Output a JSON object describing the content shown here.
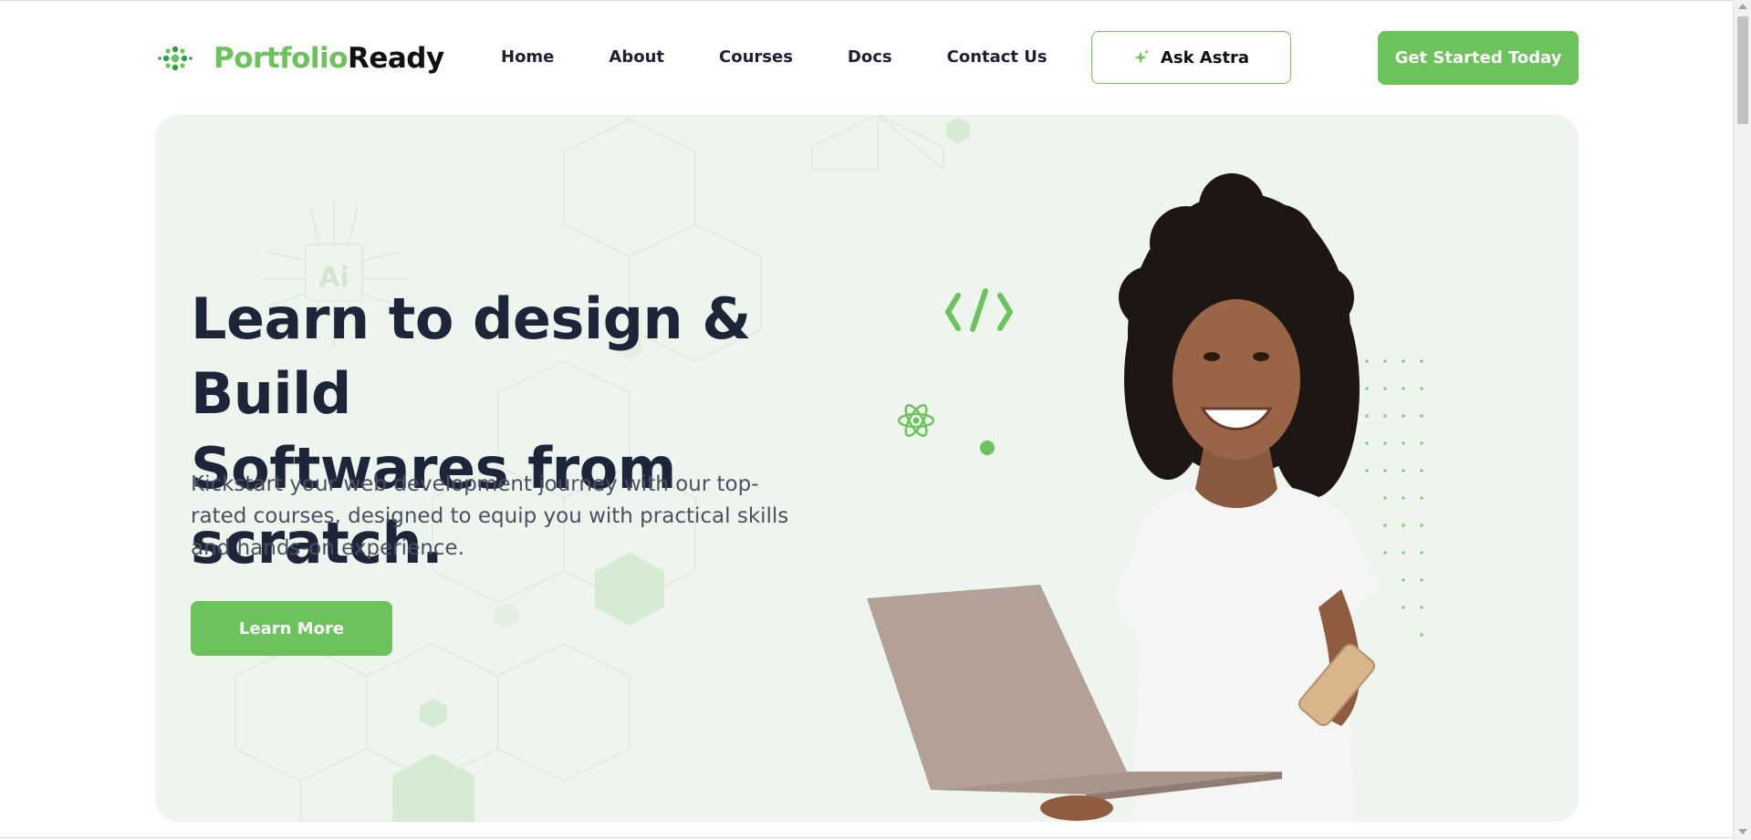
{
  "brand": {
    "part1": "Portfolio",
    "part2": "Ready",
    "icon": "dots-logo-icon"
  },
  "nav": {
    "items": [
      {
        "label": "Home"
      },
      {
        "label": "About"
      },
      {
        "label": "Courses"
      },
      {
        "label": "Docs"
      },
      {
        "label": "Contact Us"
      }
    ]
  },
  "header": {
    "ask_label": "Ask Astra",
    "ask_icon": "sparkle-icon",
    "cta_label": "Get Started Today"
  },
  "hero": {
    "title_line1": "Learn to design & Build",
    "title_line2": "Softwares from scratch.",
    "subtitle": "Kickstart your web development journey with our top-rated courses, designed to equip you with practical skills and hands-on experience.",
    "button_label": "Learn More",
    "chip_text": "Ai"
  },
  "colors": {
    "accent": "#6cc25b",
    "hero_bg": "#eef5ee",
    "heading": "#1d2638"
  }
}
